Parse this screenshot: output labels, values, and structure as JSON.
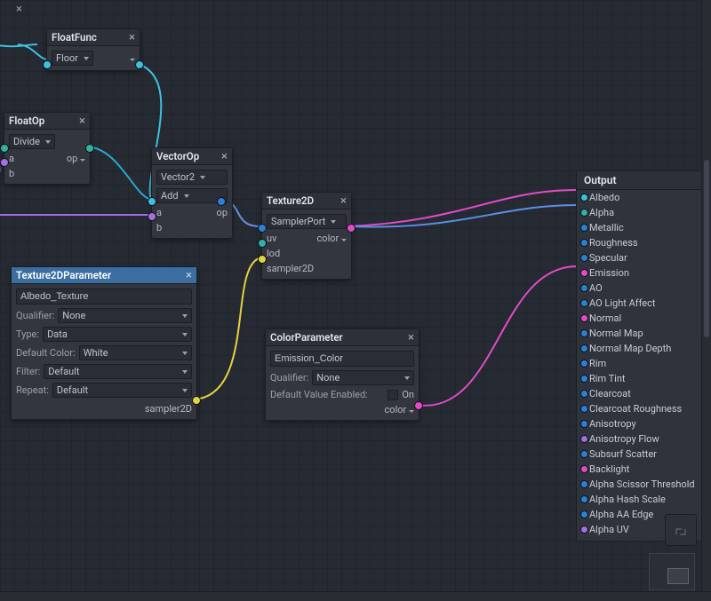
{
  "nodes": {
    "floatfunc": {
      "title": "FloatFunc",
      "fn": "Floor"
    },
    "floatop": {
      "title": "FloatOp",
      "op": "Divide",
      "port_a": "a",
      "port_b": "b",
      "out": "op"
    },
    "vectorop": {
      "title": "VectorOp",
      "vectype": "Vector2",
      "op": "Add",
      "port_a": "a",
      "port_b": "b",
      "out": "op"
    },
    "tex2d": {
      "title": "Texture2D",
      "sampler_port": "SamplerPort",
      "in_uv": "uv",
      "in_lod": "lod",
      "in_sampler": "sampler2D",
      "out_color": "color"
    },
    "tex2dparam": {
      "title": "Texture2DParameter",
      "name_value": "Albedo_Texture",
      "qualifier_label": "Qualifier:",
      "qualifier": "None",
      "type_label": "Type:",
      "type": "Data",
      "default_color_label": "Default Color:",
      "default_color": "White",
      "filter_label": "Filter:",
      "filter": "Default",
      "repeat_label": "Repeat:",
      "repeat": "Default",
      "out": "sampler2D"
    },
    "colorparam": {
      "title": "ColorParameter",
      "name_value": "Emission_Color",
      "qualifier_label": "Qualifier:",
      "qualifier": "None",
      "default_value_enabled_label": "Default Value Enabled:",
      "default_value_enabled_state": "On",
      "out": "color"
    },
    "output": {
      "title": "Output",
      "rows": [
        {
          "label": "Albedo",
          "color": "c-cyan"
        },
        {
          "label": "Alpha",
          "color": "c-teal"
        },
        {
          "label": "Metallic",
          "color": "c-blue"
        },
        {
          "label": "Roughness",
          "color": "c-blue"
        },
        {
          "label": "Specular",
          "color": "c-blue"
        },
        {
          "label": "Emission",
          "color": "c-pink"
        },
        {
          "label": "AO",
          "color": "c-blue"
        },
        {
          "label": "AO Light Affect",
          "color": "c-blue"
        },
        {
          "label": "Normal",
          "color": "c-pink"
        },
        {
          "label": "Normal Map",
          "color": "c-blue"
        },
        {
          "label": "Normal Map Depth",
          "color": "c-blue"
        },
        {
          "label": "Rim",
          "color": "c-blue"
        },
        {
          "label": "Rim Tint",
          "color": "c-blue"
        },
        {
          "label": "Clearcoat",
          "color": "c-blue"
        },
        {
          "label": "Clearcoat Roughness",
          "color": "c-blue"
        },
        {
          "label": "Anisotropy",
          "color": "c-blue"
        },
        {
          "label": "Anisotropy Flow",
          "color": "c-purple"
        },
        {
          "label": "Subsurf Scatter",
          "color": "c-blue"
        },
        {
          "label": "Backlight",
          "color": "c-pink"
        },
        {
          "label": "Alpha Scissor Threshold",
          "color": "c-blue"
        },
        {
          "label": "Alpha Hash Scale",
          "color": "c-blue"
        },
        {
          "label": "Alpha AA Edge",
          "color": "c-blue"
        },
        {
          "label": "Alpha UV",
          "color": "c-purple"
        }
      ]
    }
  }
}
